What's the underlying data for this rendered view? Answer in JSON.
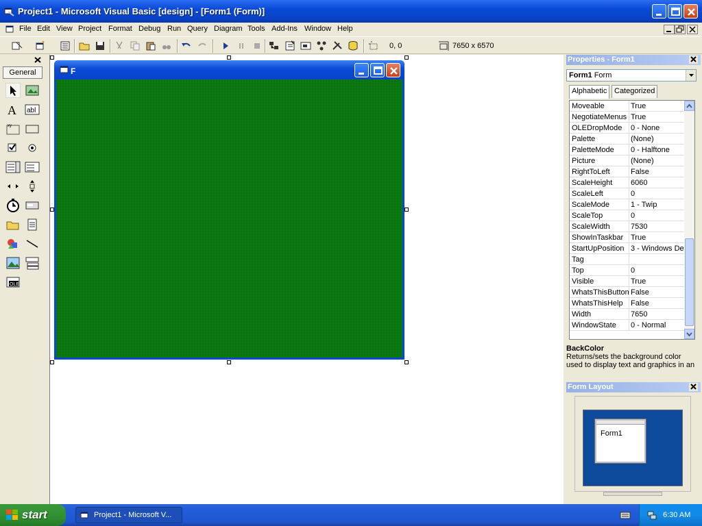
{
  "window": {
    "title": "Project1 - Microsoft Visual Basic [design] - [Form1 (Form)]"
  },
  "menu": [
    "File",
    "Edit",
    "View",
    "Project",
    "Format",
    "Debug",
    "Run",
    "Query",
    "Diagram",
    "Tools",
    "Add-Ins",
    "Window",
    "Help"
  ],
  "toolbar": {
    "position_readout": "0, 0",
    "size_readout": "7650 x 6570"
  },
  "toolbox": {
    "tab_label": "General"
  },
  "form": {
    "title": "F",
    "back_color": "#0a7a10"
  },
  "properties": {
    "title": "Properties - Form1",
    "object_name": "Form1",
    "object_type": "Form",
    "tabs": [
      "Alphabetic",
      "Categorized"
    ],
    "rows": [
      {
        "name": "Moveable",
        "value": "True"
      },
      {
        "name": "NegotiateMenus",
        "value": "True"
      },
      {
        "name": "OLEDropMode",
        "value": "0 - None"
      },
      {
        "name": "Palette",
        "value": "(None)"
      },
      {
        "name": "PaletteMode",
        "value": "0 - Halftone"
      },
      {
        "name": "Picture",
        "value": "(None)"
      },
      {
        "name": "RightToLeft",
        "value": "False"
      },
      {
        "name": "ScaleHeight",
        "value": "6060"
      },
      {
        "name": "ScaleLeft",
        "value": "0"
      },
      {
        "name": "ScaleMode",
        "value": "1 - Twip"
      },
      {
        "name": "ScaleTop",
        "value": "0"
      },
      {
        "name": "ScaleWidth",
        "value": "7530"
      },
      {
        "name": "ShowInTaskbar",
        "value": "True"
      },
      {
        "name": "StartUpPosition",
        "value": "3 - Windows Def"
      },
      {
        "name": "Tag",
        "value": ""
      },
      {
        "name": "Top",
        "value": "0"
      },
      {
        "name": "Visible",
        "value": "True"
      },
      {
        "name": "WhatsThisButton",
        "value": "False"
      },
      {
        "name": "WhatsThisHelp",
        "value": "False"
      },
      {
        "name": "Width",
        "value": "7650"
      },
      {
        "name": "WindowState",
        "value": "0 - Normal"
      }
    ],
    "desc_title": "BackColor",
    "desc_text": "Returns/sets the background color used to display text and graphics in an"
  },
  "form_layout": {
    "title": "Form Layout",
    "form_label": "Form1"
  },
  "taskbar": {
    "start_label": "start",
    "task_label": "Project1 - Microsoft V...",
    "clock": "6:30 AM"
  }
}
